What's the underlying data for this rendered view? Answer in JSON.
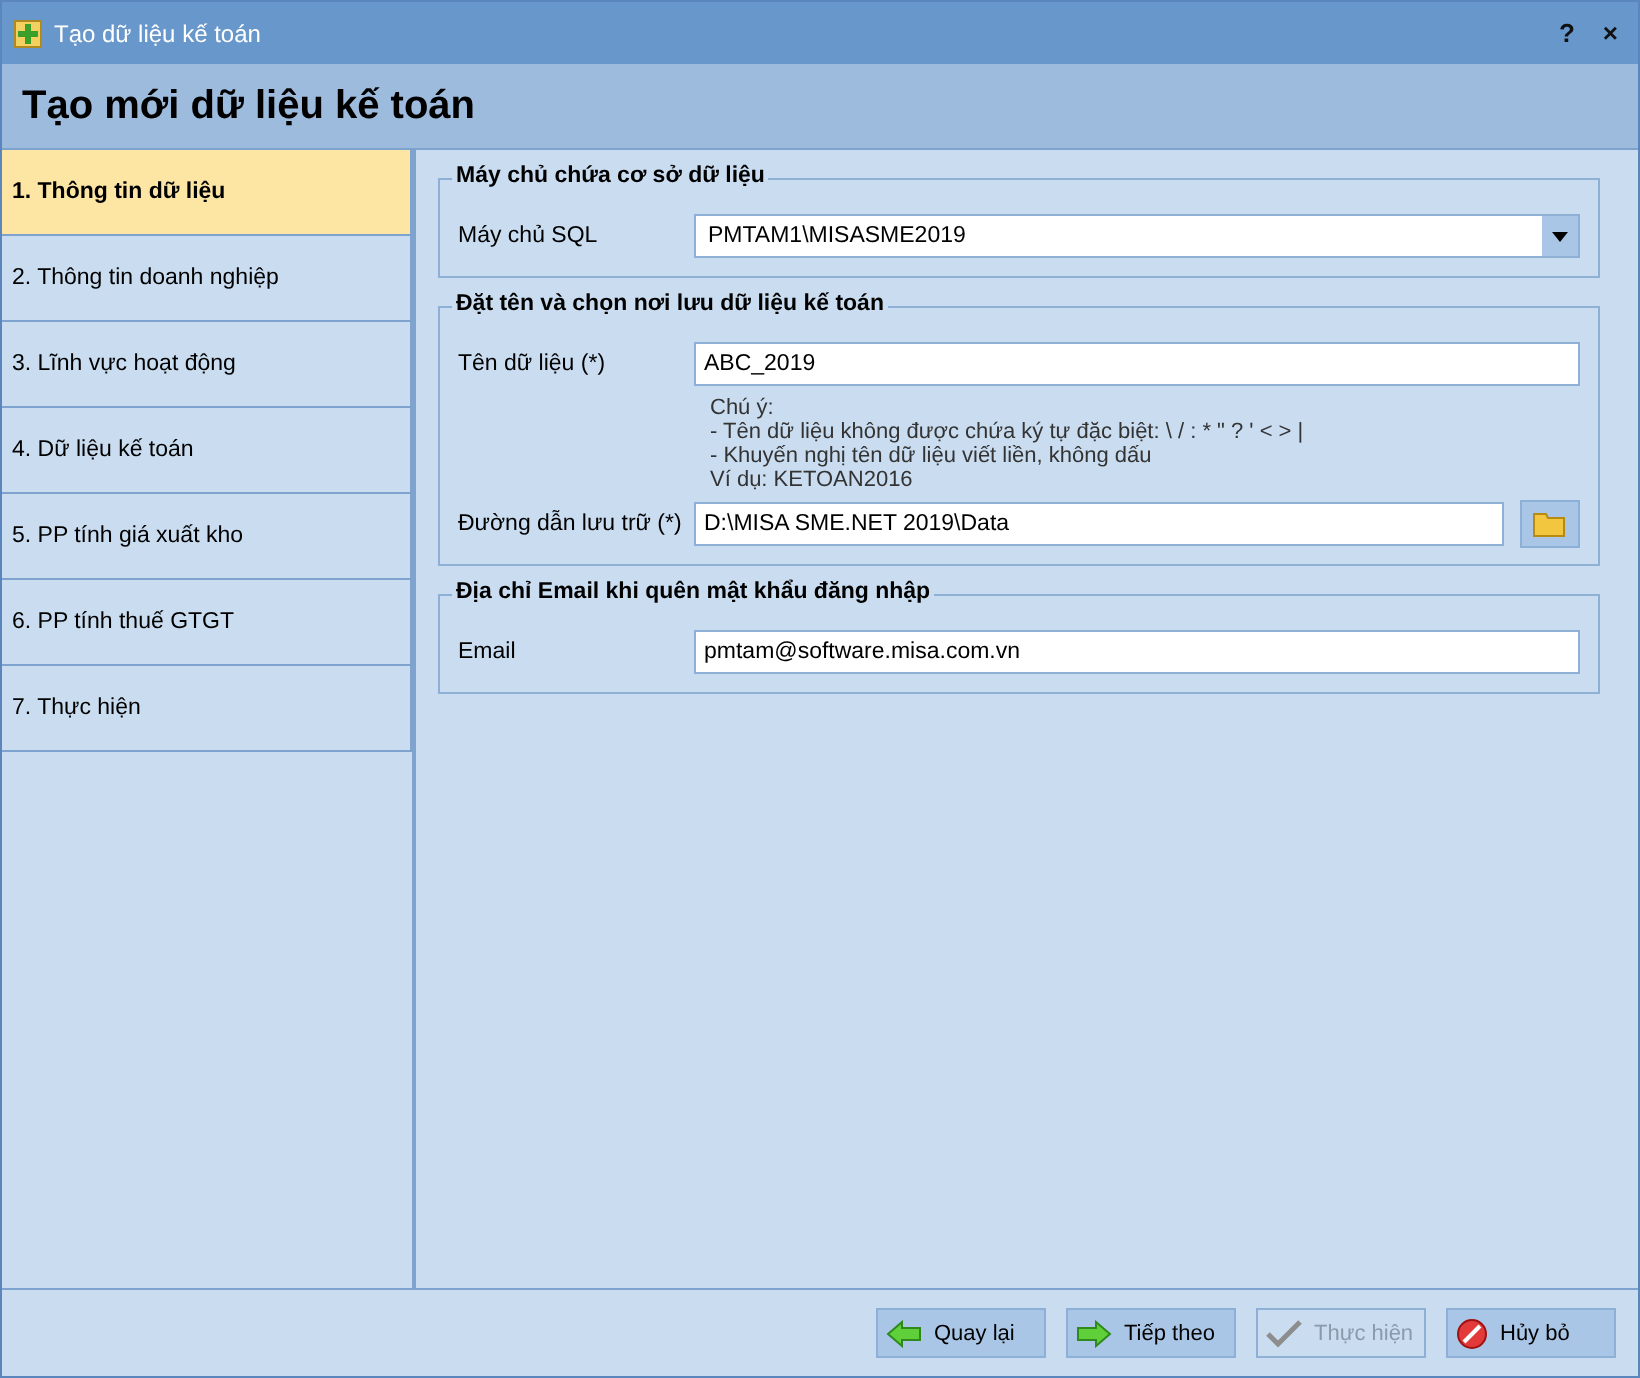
{
  "window": {
    "title": "Tạo dữ liệu kế toán",
    "help": "?",
    "close": "×"
  },
  "header": "Tạo mới dữ liệu kế toán",
  "steps": [
    {
      "label": "1. Thông tin dữ liệu",
      "selected": true
    },
    {
      "label": "2. Thông tin doanh nghiệp",
      "selected": false
    },
    {
      "label": "3. Lĩnh vực hoạt động",
      "selected": false
    },
    {
      "label": "4. Dữ liệu kế toán",
      "selected": false
    },
    {
      "label": "5. PP tính giá xuất kho",
      "selected": false
    },
    {
      "label": "6. PP tính thuế GTGT",
      "selected": false
    },
    {
      "label": "7. Thực hiện",
      "selected": false
    }
  ],
  "groups": [
    {
      "title": "Máy chủ chứa cơ sở dữ liệu",
      "fields": [
        {
          "kind": "dropdown",
          "label": "Máy chủ SQL",
          "value": "PMTAM1\\MISASME2019"
        }
      ]
    },
    {
      "title": "Đặt tên và chọn nơi lưu dữ liệu kế toán",
      "fields": [
        {
          "kind": "text",
          "label": "Tên dữ liệu (*)",
          "value": "ABC_2019"
        },
        {
          "kind": "note",
          "lines": [
            "Chú ý:",
            "- Tên dữ liệu không được chứa ký tự đặc biệt: \\ / : * \" ? ' < > |",
            "- Khuyến nghị tên dữ liệu viết liền, không dấu",
            "Ví dụ: KETOAN2016"
          ]
        },
        {
          "kind": "folder",
          "label": "Đường dẫn lưu trữ (*)",
          "value": "D:\\MISA SME.NET 2019\\Data"
        }
      ]
    },
    {
      "title": "Địa chỉ Email khi quên mật khẩu đăng nhập",
      "fields": [
        {
          "kind": "text",
          "label": "Email",
          "value": "pmtam@software.misa.com.vn"
        }
      ]
    }
  ],
  "buttons": [
    {
      "kind": "back",
      "label": "Quay lại",
      "disabled": false
    },
    {
      "kind": "next",
      "label": "Tiếp theo",
      "disabled": false
    },
    {
      "kind": "finish",
      "label": "Thực hiện",
      "disabled": true
    },
    {
      "kind": "cancel",
      "label": "Hủy bỏ",
      "disabled": false
    }
  ]
}
